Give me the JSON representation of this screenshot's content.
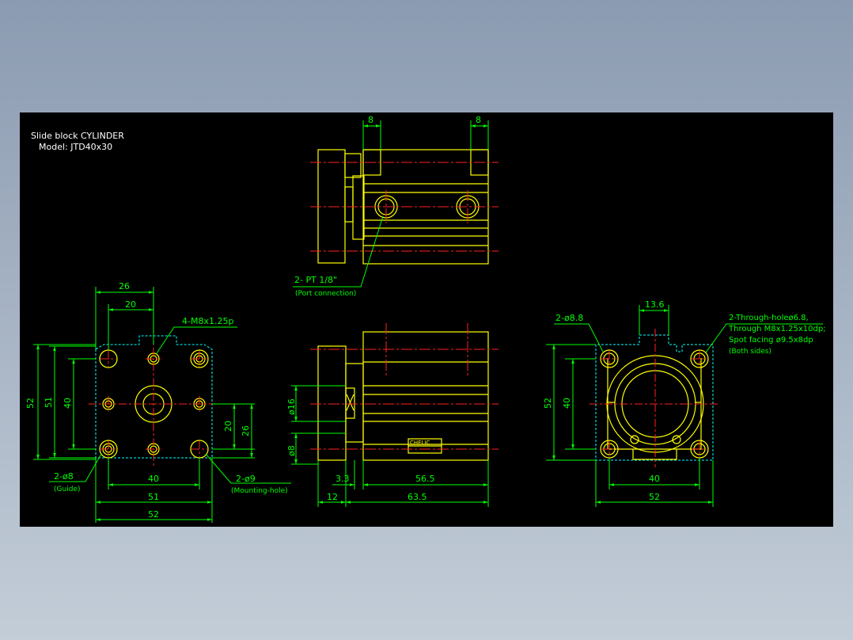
{
  "header": {
    "title": "Slide block CYLINDER",
    "model": "Model:  JTD40x30"
  },
  "colors": {
    "background": "#000000",
    "outline": "#ffff00",
    "dimension": "#00ff00",
    "center": "#ff2020",
    "hidden": "#00ffff",
    "text": "#ffffff"
  },
  "top_view": {
    "dim_left": "8",
    "dim_right": "8",
    "port_label": "2-  PT 1/8\"",
    "port_note": "(Port connection)"
  },
  "left_view": {
    "dim_26": "26",
    "dim_20_top": "20",
    "thread_label": "4-M8x1.25p",
    "dim_52_v": "52",
    "dim_51_v": "51",
    "dim_40_v": "40",
    "dim_20_v": "20",
    "dim_26_v": "26",
    "guide_label": "2-ø8",
    "guide_note": "(Guide)",
    "mount_label": "2-ø9",
    "mount_note": "(Mounting-hole)",
    "dim_40_h": "40",
    "dim_51_h": "51",
    "dim_52_h": "52"
  },
  "front_view": {
    "dim_d16": "ø16",
    "dim_d8": "ø8",
    "dim_3_3": "3.3",
    "dim_56_5": "56.5",
    "dim_12": "12",
    "dim_63_5": "63.5",
    "label_brand": "CHELIC"
  },
  "right_view": {
    "dim_13_6": "13.6",
    "hole_label": "2-ø8.8",
    "through_1": "2-Through-holeø6.8,",
    "through_2": "Through M8x1.25x10dp;",
    "through_3": "Spot facing ø9.5x8dp",
    "through_4": "(Both sides)",
    "dim_52_v": "52",
    "dim_40_v": "40",
    "dim_40_h": "40",
    "dim_52_h": "52"
  }
}
